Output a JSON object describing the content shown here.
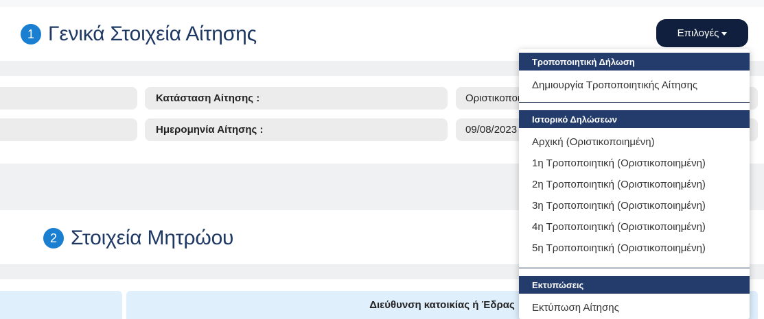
{
  "section1": {
    "number": "1",
    "title": "Γενικά Στοιχεία Αίτησης"
  },
  "section2": {
    "number": "2",
    "title": "Στοιχεία Μητρώου"
  },
  "fields": {
    "status_label": "Κατάσταση Αίτησης :",
    "status_value": "Οριστικοποιημένη",
    "date_label": "Ημερομηνία Αίτησης :",
    "date_value": "09/08/2023"
  },
  "table_header": {
    "address": "Διεύθυνση κατοικίας ή Έδρας"
  },
  "options_button": {
    "label": "Επιλογές"
  },
  "dropdown": {
    "group1": {
      "header": "Τροποποιητική Δήλωση",
      "items": [
        "Δημιουργία Τροποποιητικής Αίτησης"
      ]
    },
    "group2": {
      "header": "Ιστορικό Δηλώσεων",
      "items": [
        "Αρχική (Οριστικοποιημένη)",
        "1η Τροποποιητική (Οριστικοποιημένη)",
        "2η Τροποποιητική (Οριστικοποιημένη)",
        "3η Τροποποιητική (Οριστικοποιημένη)",
        "4η Τροποποιητική (Οριστικοποιημένη)",
        "5η Τροποποιητική (Οριστικοποιημένη)"
      ]
    },
    "group3": {
      "header": "Εκτυπώσεις",
      "items": [
        "Εκτύπωση Αίτησης"
      ]
    }
  },
  "colors": {
    "accent_blue": "#1a7fd1",
    "title_navy": "#1e3864",
    "button_dark": "#0f1f3d",
    "dropdown_header": "#233c6c"
  }
}
